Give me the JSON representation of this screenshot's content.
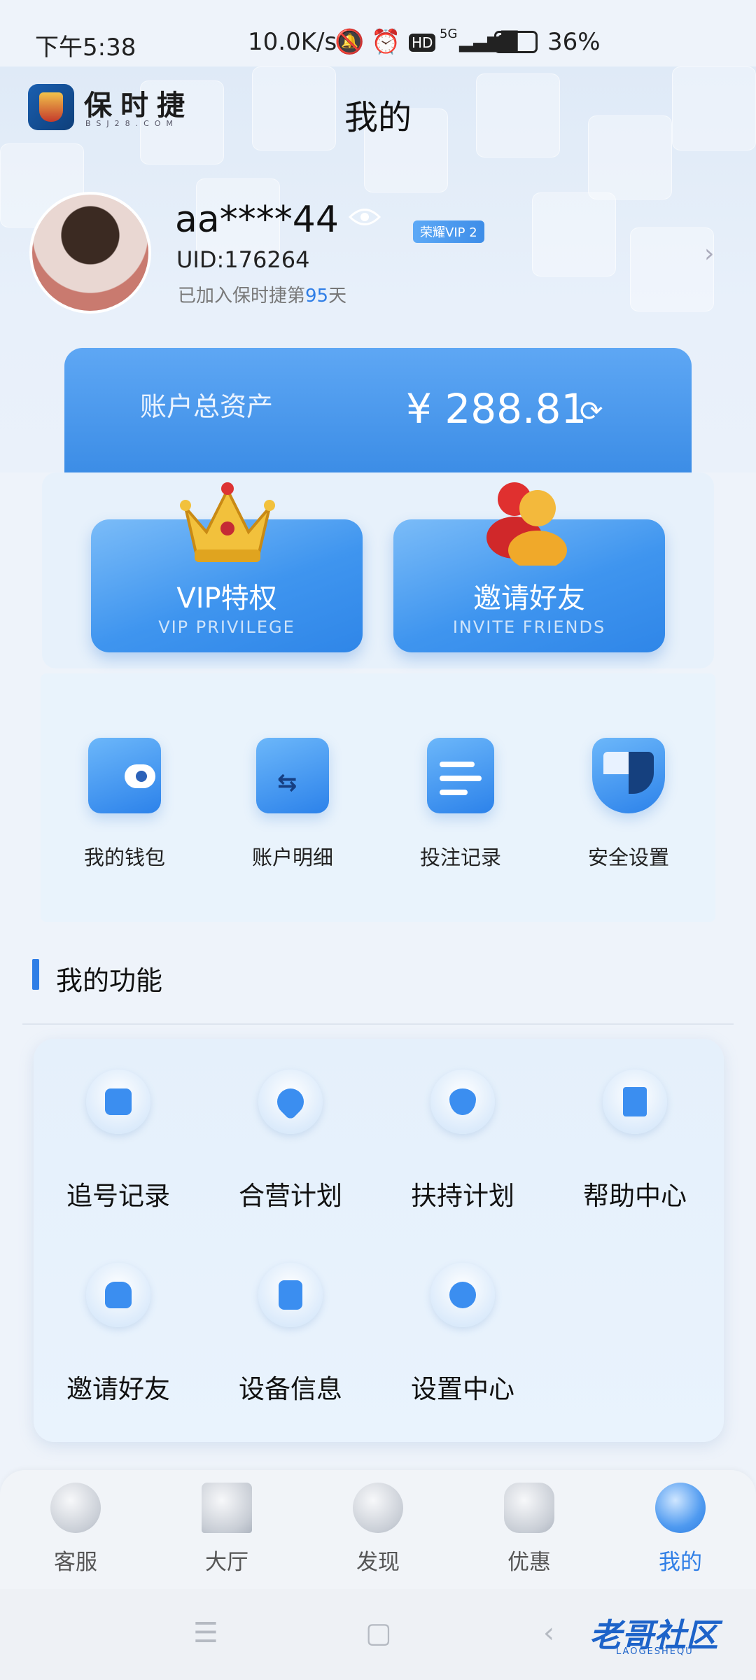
{
  "status_bar": {
    "time": "下午5:38",
    "network_speed": "10.0K/s",
    "battery": "36%",
    "signal": "5G"
  },
  "header": {
    "logo_text": "保时捷",
    "logo_sub": "BSJ28.COM",
    "title": "我的"
  },
  "profile": {
    "username": "aa****44",
    "vip_badge": "荣耀VIP 2",
    "uid": "UID:176264",
    "joined_prefix": "已加入保时捷第",
    "joined_days": "95",
    "joined_suffix": "天"
  },
  "assets": {
    "label": "账户总资产",
    "value": "¥ 288.81"
  },
  "promos": [
    {
      "title": "VIP特权",
      "subtitle": "VIP PRIVILEGE",
      "icon": "crown-icon"
    },
    {
      "title": "邀请好友",
      "subtitle": "INVITE FRIENDS",
      "icon": "people-icon"
    }
  ],
  "quick_actions": [
    {
      "label": "我的钱包",
      "icon": "wallet-icon"
    },
    {
      "label": "账户明细",
      "icon": "folder-transfer-icon"
    },
    {
      "label": "投注记录",
      "icon": "document-icon"
    },
    {
      "label": "安全设置",
      "icon": "shield-icon"
    }
  ],
  "functions": {
    "title": "我的功能",
    "items": [
      {
        "label": "追号记录",
        "icon": "record-icon"
      },
      {
        "label": "合营计划",
        "icon": "handshake-icon"
      },
      {
        "label": "扶持计划",
        "icon": "support-icon"
      },
      {
        "label": "帮助中心",
        "icon": "book-icon"
      },
      {
        "label": "邀请好友",
        "icon": "invite-icon"
      },
      {
        "label": "设备信息",
        "icon": "tablet-icon"
      },
      {
        "label": "设置中心",
        "icon": "settings-icon"
      }
    ]
  },
  "tabs": [
    {
      "label": "客服",
      "icon": "customer-service-icon",
      "active": false
    },
    {
      "label": "大厅",
      "icon": "home-icon",
      "active": false
    },
    {
      "label": "发现",
      "icon": "discover-icon",
      "active": false
    },
    {
      "label": "优惠",
      "icon": "promotion-icon",
      "active": false
    },
    {
      "label": "我的",
      "icon": "profile-icon",
      "active": true
    }
  ],
  "watermark": {
    "text": "老哥社区",
    "sub": "LAOGESHEQU"
  },
  "colors": {
    "accent": "#2f7ee6",
    "card_blue": "#3c8de6"
  }
}
